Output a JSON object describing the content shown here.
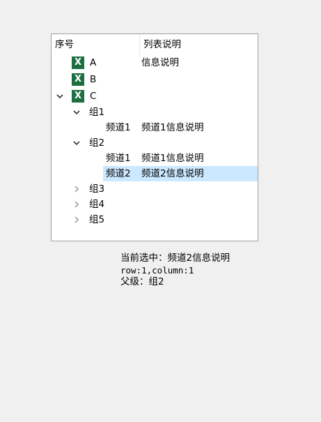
{
  "tree": {
    "columns": [
      "序号",
      "列表说明"
    ],
    "rows": {
      "a": {
        "icon": "X",
        "label": "A",
        "desc": "信息说明"
      },
      "b": {
        "icon": "X",
        "label": "B"
      },
      "c": {
        "icon": "X",
        "label": "C"
      },
      "g1": {
        "label": "组1"
      },
      "g1_ch1": {
        "label": "频道1",
        "desc": "频道1信息说明"
      },
      "g2": {
        "label": "组2"
      },
      "g2_ch1": {
        "label": "频道1",
        "desc": "频道1信息说明"
      },
      "g2_ch2": {
        "label": "频道2",
        "desc": "频道2信息说明",
        "selected": true
      },
      "g3": {
        "label": "组3"
      },
      "g4": {
        "label": "组4"
      },
      "g5": {
        "label": "组5"
      }
    }
  },
  "status": {
    "selected_line": "当前选中：频道2信息说明",
    "rowcol_line": "row:1,column:1",
    "parent_line": "父级：组2"
  },
  "colors": {
    "selection": "#cce8ff",
    "excel_icon": "#1d6f42"
  }
}
